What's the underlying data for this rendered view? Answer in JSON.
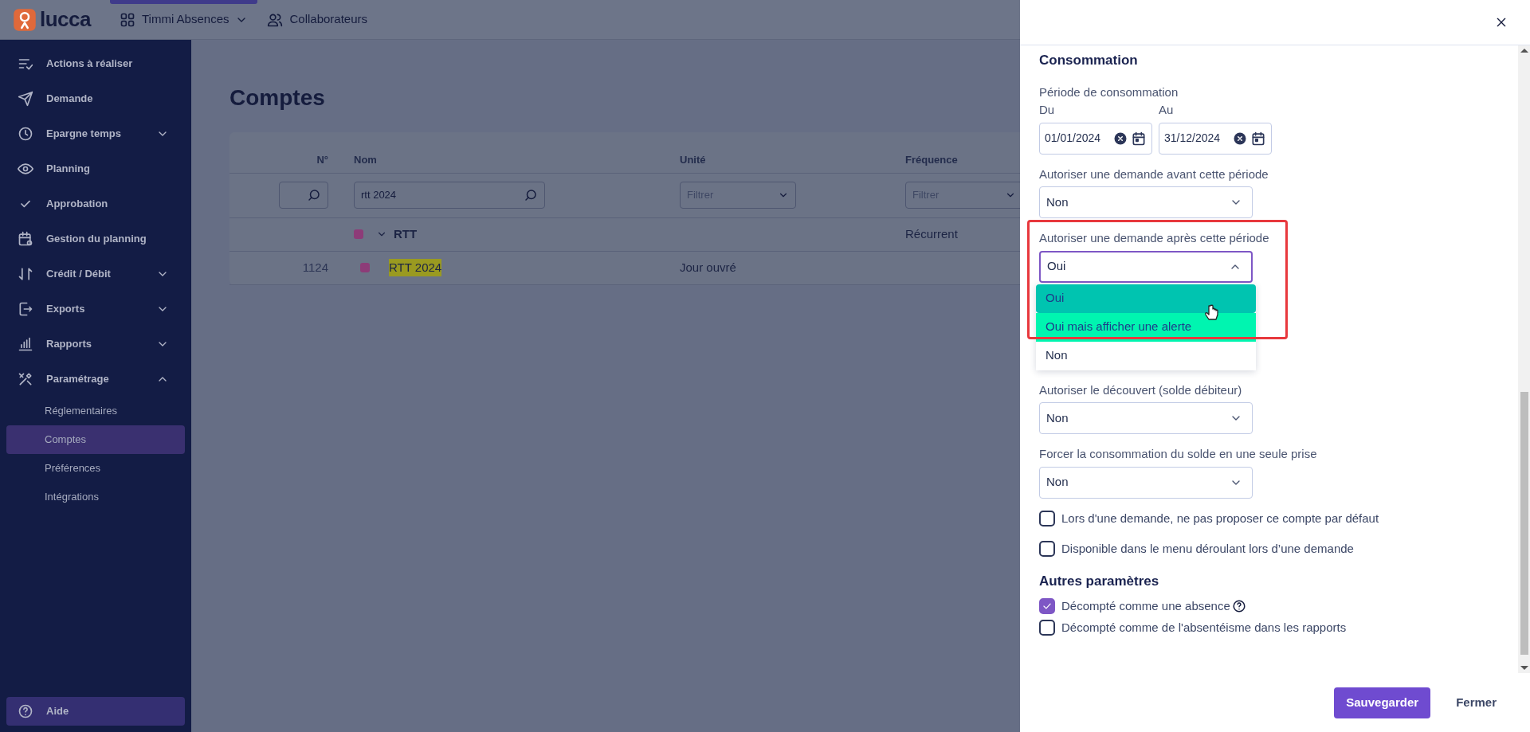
{
  "header": {
    "logo": "lucca",
    "nav": [
      {
        "label": "Timmi Absences",
        "selected": true,
        "has_menu": true
      },
      {
        "label": "Collaborateurs",
        "selected": false,
        "has_menu": false
      }
    ]
  },
  "sidebar": {
    "items": [
      {
        "label": "Actions à réaliser",
        "kind": "link"
      },
      {
        "label": "Demande",
        "kind": "link"
      },
      {
        "label": "Epargne temps",
        "kind": "group",
        "expanded": false
      },
      {
        "label": "Planning",
        "kind": "link"
      },
      {
        "label": "Approbation",
        "kind": "link"
      },
      {
        "label": "Gestion du planning",
        "kind": "link"
      },
      {
        "label": "Crédit / Débit",
        "kind": "group",
        "expanded": false
      },
      {
        "label": "Exports",
        "kind": "group",
        "expanded": false
      },
      {
        "label": "Rapports",
        "kind": "group",
        "expanded": false
      },
      {
        "label": "Paramétrage",
        "kind": "group",
        "expanded": true,
        "children": [
          {
            "label": "Réglementaires",
            "selected": false
          },
          {
            "label": "Comptes",
            "selected": true
          },
          {
            "label": "Préférences",
            "selected": false
          },
          {
            "label": "Intégrations",
            "selected": false
          }
        ]
      }
    ],
    "help": "Aide"
  },
  "page": {
    "title": "Comptes",
    "table": {
      "columns": [
        "N°",
        "Nom",
        "Unité",
        "Fréquence"
      ],
      "filters": [
        {
          "kind": "search"
        },
        {
          "kind": "search",
          "value": "rtt 2024"
        },
        {
          "kind": "select",
          "placeholder": "Filtrer"
        },
        {
          "kind": "select",
          "placeholder": "Filtrer"
        }
      ],
      "rows": [
        {
          "kind": "group",
          "name": "RTT",
          "frequency": "Récurrent",
          "color": "#8d3c78",
          "expanded": true,
          "highlighted": false
        },
        {
          "kind": "account",
          "number": "1124",
          "name": "RTT 2024",
          "unit": "Jour ouvré",
          "color": "#8d3c78",
          "highlighted": true
        }
      ]
    }
  },
  "panel": {
    "sections": [
      {
        "title": "Consommation",
        "fields": [
          {
            "kind": "date_range",
            "label": "Période de consommation",
            "from_label": "Du",
            "from": "01/01/2024",
            "to_label": "Au",
            "to": "31/12/2024"
          },
          {
            "kind": "select",
            "label": "Autoriser une demande avant cette période",
            "value": "Non",
            "open": false,
            "annotated": false
          },
          {
            "kind": "select",
            "label": "Autoriser une demande après cette période",
            "value": "Oui",
            "open": true,
            "annotated": true,
            "options": [
              {
                "label": "Oui",
                "selected": true,
                "hovered": false
              },
              {
                "label": "Oui mais afficher une alerte",
                "selected": false,
                "hovered": true
              },
              {
                "label": "Non",
                "selected": false,
                "hovered": false
              }
            ]
          },
          {
            "kind": "select",
            "label": "Autoriser le découvert (solde débiteur)",
            "value": "Non",
            "open": false,
            "annotated": false
          },
          {
            "kind": "select",
            "label": "Forcer la consommation du solde en une seule prise",
            "value": "Non",
            "open": false,
            "annotated": false
          },
          {
            "kind": "checkbox",
            "label": "Lors d'une demande, ne pas proposer ce compte par défaut",
            "checked": false
          },
          {
            "kind": "checkbox",
            "label": "Disponible dans le menu déroulant lors d’une demande",
            "checked": false
          }
        ]
      },
      {
        "title": "Autres paramètres",
        "fields": [
          {
            "kind": "checkbox",
            "label": "Décompté comme une absence",
            "checked": true,
            "help": true
          },
          {
            "kind": "checkbox",
            "label": "Décompté comme de l'absentéisme dans les rapports",
            "checked": false
          }
        ]
      }
    ],
    "buttons": [
      {
        "label": "Sauvegarder",
        "kind": "primary"
      },
      {
        "label": "Fermer",
        "kind": "link"
      }
    ]
  }
}
